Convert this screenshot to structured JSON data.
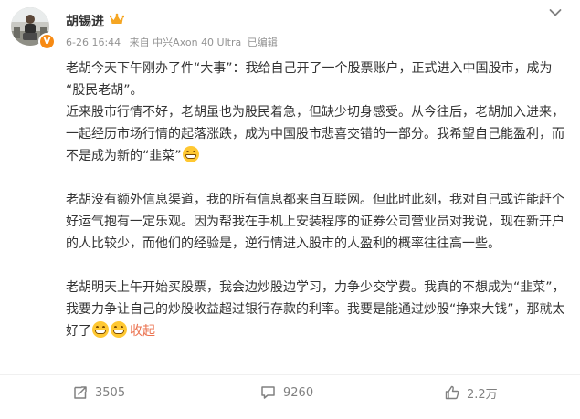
{
  "post": {
    "author": "胡锡进",
    "meta": {
      "time": "6-26 16:44",
      "source": "来自 中兴Axon 40 Ultra",
      "edited": "已编辑"
    },
    "verified_mark": "V",
    "paragraphs": {
      "p1": "老胡今天下午刚办了件“大事”：我给自己开了一个股票账户，正式进入中国股市，成为 “股民老胡”。",
      "p2": "近来股市行情不好，老胡虽也为股民着急，但缺少切身感受。从今往后，老胡加入进来，一起经历市场行情的起落涨跌，成为中国股市悲喜交错的一部分。我希望自己能盈利，而不是成为新的“韭菜”",
      "p3": "老胡没有额外信息渠道，我的所有信息都来自互联网。但此时此刻，我对自己或许能赶个好运气抱有一定乐观。因为帮我在手机上安装程序的证券公司营业员对我说，现在新开户的人比较少，而他们的经验是，逆行情进入股市的人盈利的概率往往高一些。",
      "p4": "老胡明天上午开始买股票，我会边炒股边学习，力争少交学费。我真的不想成为“韭菜”，我要力争让自己的炒股收益超过银行存款的利率。我要是能通过炒股“挣来大钱”，那就太好了"
    },
    "collapse_label": "收起",
    "icons": {
      "menu": "chevron-down-icon",
      "crown": "crown-icon",
      "emoji": "grin-emoji-icon",
      "repost": "repost-icon",
      "comment": "comment-icon",
      "like": "thumbs-up-icon"
    }
  },
  "actions": {
    "repost_count": "3505",
    "comment_count": "9260",
    "like_count": "2.2万"
  },
  "colors": {
    "text": "#333333",
    "meta": "#939393",
    "link": "#eb7350",
    "badge": "#f78a13",
    "action": "#808080"
  }
}
